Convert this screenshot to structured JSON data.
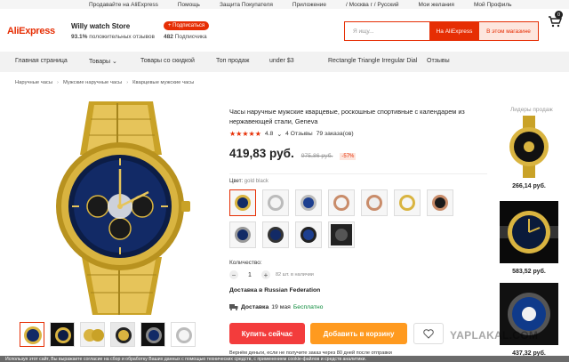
{
  "topbar": {
    "items": [
      "Продавайте на AliExpress",
      "Помощь",
      "Защита Покупателя",
      "Приложение",
      "/ Москва г / Русский",
      "Мои желания",
      "Мой Профиль"
    ]
  },
  "header": {
    "logo": "AliExpress",
    "store_name": "Willy watch Store",
    "positive_pct": "93.1%",
    "positive_text": "положительных отзывов",
    "subscribe_label": "+ Подписаться",
    "subscribers_count": "482",
    "subscribers_text": "Подписчика",
    "search_placeholder": "Я ищу...",
    "search_ali_label": "На AliExpress",
    "search_store_label": "В этом магазине",
    "cart_count": "0"
  },
  "nav": {
    "items": [
      "Главная страница",
      "Товары",
      "Товары со скидкой",
      "Топ продаж",
      "under $3",
      "Rectangle Triangle Irregular Dial",
      "Отзывы"
    ]
  },
  "breadcrumb": [
    "Наручные часы",
    "Мужские наручные часы",
    "Кварцевые мужские часы"
  ],
  "product": {
    "title": "Часы наручные мужские кварцевые, роскошные спортивные с календарем из нержавеющей стали, Geneva",
    "stars": "★★★★★",
    "rating": "4.8",
    "reviews": "4 Отзывы",
    "orders": "79 заказа(ов)",
    "price": "419,83 руб.",
    "old_price": "975,86 руб.",
    "discount": "-57%",
    "color_label": "Цвет:",
    "color_value": "gold black",
    "qty_label": "Количество:",
    "qty_minus": "−",
    "qty_value": "1",
    "qty_plus": "+",
    "stock": "82 шт. в наличии",
    "ship_to_prefix": "Доставка в",
    "ship_to_country": "Russian Federation",
    "delivery_label": "Доставка",
    "delivery_date": "19 мая",
    "delivery_price": "Бесплатно",
    "buy_now": "Купить сейчас",
    "add_to_cart": "Добавить в корзину"
  },
  "side": {
    "title": "Лидеры продаж",
    "prices": [
      "266,14 руб.",
      "583,52 руб.",
      "437,32 руб."
    ]
  },
  "watermark": "YAPLAKAL.COM",
  "notice": "Вернём деньги, если не получите заказ через 80 дней после отправки",
  "cookie_text": "Используя этот сайт, Вы выражаете согласие на сбор и обработку Ваших данных с помощью технических средств, с применением cookie-файлов и средств аналитики.",
  "colors": {
    "accent": "#e62e04",
    "buy_now": "#f33c3c",
    "add_cart": "#ff9a1f"
  }
}
